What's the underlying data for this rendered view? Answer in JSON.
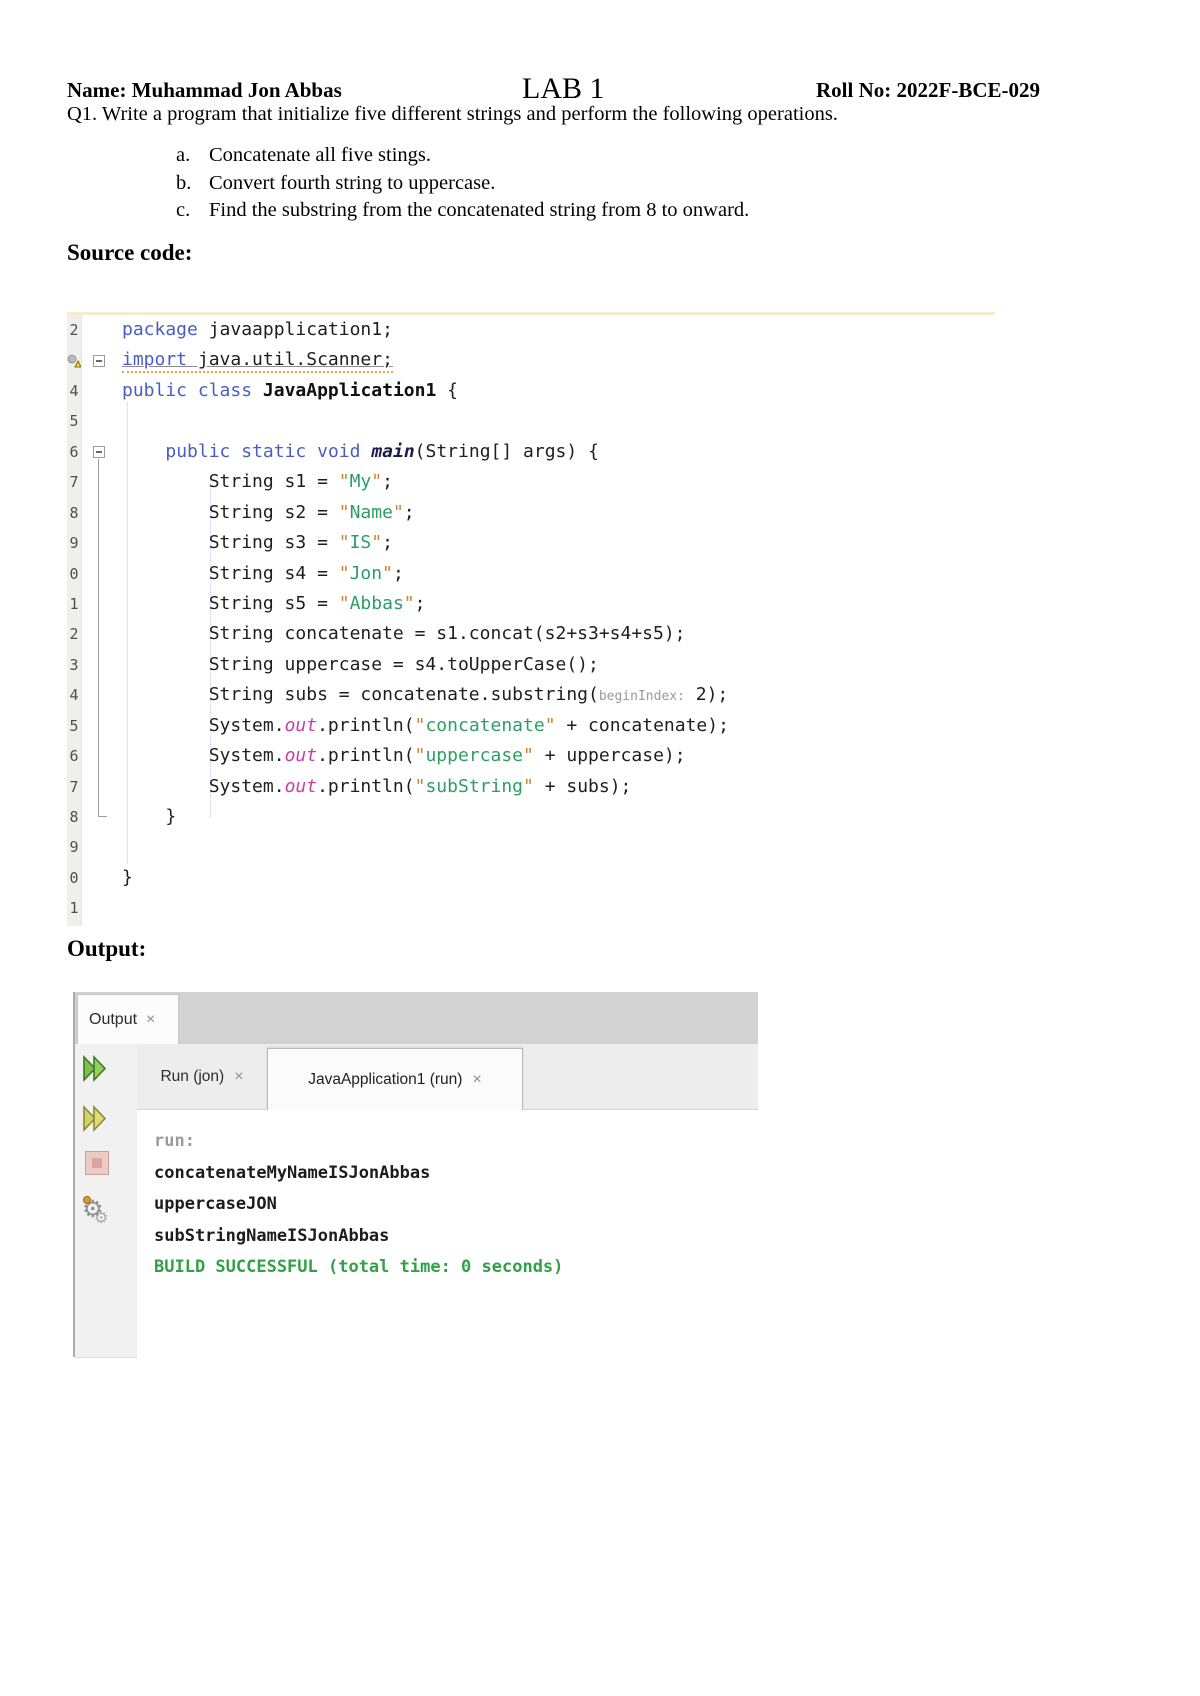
{
  "document": {
    "name_label": "Name: Muhammad Jon Abbas",
    "lab_title": "LAB 1",
    "roll_label": "Roll No: 2022F-BCE-029",
    "question": "Q1. Write a program that initialize five different strings and perform the following operations.",
    "tasks": [
      {
        "marker": "a.",
        "text": "Concatenate all five stings."
      },
      {
        "marker": "b.",
        "text": "Convert fourth string to uppercase."
      },
      {
        "marker": "c.",
        "text": "Find the substring from the concatenated string from 8 to onward."
      }
    ],
    "source_heading": "Source code:",
    "output_heading": "Output:"
  },
  "editor": {
    "lines": [
      {
        "num": "2",
        "tokens": [
          [
            "kw",
            "package"
          ],
          [
            "pl",
            " javaapplication1;"
          ]
        ]
      },
      {
        "num": "",
        "warning": true,
        "unused": true,
        "tokens": [
          [
            "kw",
            "import"
          ],
          [
            "pl",
            " java.util.Scanner;"
          ]
        ]
      },
      {
        "num": "4",
        "tokens": [
          [
            "kw",
            "public"
          ],
          [
            "pl",
            " "
          ],
          [
            "kw",
            "class"
          ],
          [
            "pl",
            " "
          ],
          [
            "cls",
            "JavaApplication1"
          ],
          [
            "pl",
            " {"
          ]
        ]
      },
      {
        "num": "5",
        "tokens": []
      },
      {
        "num": "6",
        "tokens": [
          [
            "pl",
            "    "
          ],
          [
            "kw",
            "public"
          ],
          [
            "pl",
            " "
          ],
          [
            "kw",
            "static"
          ],
          [
            "pl",
            " "
          ],
          [
            "kw",
            "void"
          ],
          [
            "pl",
            " "
          ],
          [
            "main",
            "main"
          ],
          [
            "pl",
            "(String[] args) {"
          ]
        ]
      },
      {
        "num": "7",
        "tokens": [
          [
            "pl",
            "        String s1 = "
          ],
          [
            "q",
            "\""
          ],
          [
            "str",
            "My"
          ],
          [
            "q",
            "\""
          ],
          [
            "pl",
            ";"
          ]
        ]
      },
      {
        "num": "8",
        "tokens": [
          [
            "pl",
            "        String s2 = "
          ],
          [
            "q",
            "\""
          ],
          [
            "str",
            "Name"
          ],
          [
            "q",
            "\""
          ],
          [
            "pl",
            ";"
          ]
        ]
      },
      {
        "num": "9",
        "tokens": [
          [
            "pl",
            "        String s3 = "
          ],
          [
            "q",
            "\""
          ],
          [
            "str",
            "IS"
          ],
          [
            "q",
            "\""
          ],
          [
            "pl",
            ";"
          ]
        ]
      },
      {
        "num": "0",
        "tokens": [
          [
            "pl",
            "        String s4 = "
          ],
          [
            "q",
            "\""
          ],
          [
            "str",
            "Jon"
          ],
          [
            "q",
            "\""
          ],
          [
            "pl",
            ";"
          ]
        ]
      },
      {
        "num": "1",
        "tokens": [
          [
            "pl",
            "        String s5 = "
          ],
          [
            "q",
            "\""
          ],
          [
            "str",
            "Abbas"
          ],
          [
            "q",
            "\""
          ],
          [
            "pl",
            ";"
          ]
        ]
      },
      {
        "num": "2",
        "tokens": [
          [
            "pl",
            "        String concatenate = s1.concat(s2+s3+s4+s5);"
          ]
        ]
      },
      {
        "num": "3",
        "tokens": [
          [
            "pl",
            "        String uppercase = s4.toUpperCase();"
          ]
        ]
      },
      {
        "num": "4",
        "tokens": [
          [
            "pl",
            "        String subs = concatenate.substring("
          ],
          [
            "hint",
            "beginIndex:"
          ],
          [
            "pl",
            " 2);"
          ]
        ]
      },
      {
        "num": "5",
        "tokens": [
          [
            "pl",
            "        System."
          ],
          [
            "fld",
            "out"
          ],
          [
            "pl",
            ".println("
          ],
          [
            "q",
            "\""
          ],
          [
            "str",
            "concatenate"
          ],
          [
            "q",
            "\""
          ],
          [
            "pl",
            " + concatenate);"
          ]
        ]
      },
      {
        "num": "6",
        "tokens": [
          [
            "pl",
            "        System."
          ],
          [
            "fld",
            "out"
          ],
          [
            "pl",
            ".println("
          ],
          [
            "q",
            "\""
          ],
          [
            "str",
            "uppercase"
          ],
          [
            "q",
            "\""
          ],
          [
            "pl",
            " + uppercase);"
          ]
        ]
      },
      {
        "num": "7",
        "tokens": [
          [
            "pl",
            "        System."
          ],
          [
            "fld",
            "out"
          ],
          [
            "pl",
            ".println("
          ],
          [
            "q",
            "\""
          ],
          [
            "str",
            "subString"
          ],
          [
            "q",
            "\""
          ],
          [
            "pl",
            " + subs);"
          ]
        ]
      },
      {
        "num": "8",
        "tokens": [
          [
            "pl",
            "    }"
          ]
        ]
      },
      {
        "num": "9",
        "tokens": []
      },
      {
        "num": "0",
        "tokens": [
          [
            "pl",
            "}"
          ]
        ]
      },
      {
        "num": "1",
        "tokens": []
      }
    ]
  },
  "output_panel": {
    "window_tab": {
      "label": "Output",
      "close_glyph": "×"
    },
    "tabs": [
      {
        "label": "Run (jon)",
        "close_glyph": "×",
        "active": false
      },
      {
        "label": "JavaApplication1 (run)",
        "close_glyph": "×",
        "active": true
      }
    ],
    "toolbar_icons": [
      "rerun-icon",
      "rerun-with-changes-icon",
      "stop-icon",
      "settings-gears-icon"
    ],
    "console": [
      {
        "style": "muted",
        "text": "run:"
      },
      {
        "style": "plain",
        "text": "concatenateMyNameISJonAbbas"
      },
      {
        "style": "plain",
        "text": "uppercaseJON"
      },
      {
        "style": "plain",
        "text": "subStringNameISJonAbbas"
      },
      {
        "style": "success",
        "text": "BUILD SUCCESSFUL (total time: 0 seconds)"
      }
    ]
  },
  "colors": {
    "keyword_blue": "#4a5cc5",
    "string_green": "#2d9e63",
    "quote_orange": "#c9822e",
    "field_pink": "#c73fa6",
    "hint_gray": "#9a9a9a",
    "success_green": "#33a047",
    "warning_orange": "#eda43a",
    "tabstrip_gray": "#d2d2d2",
    "gutter_gray": "#f1f1f1"
  }
}
